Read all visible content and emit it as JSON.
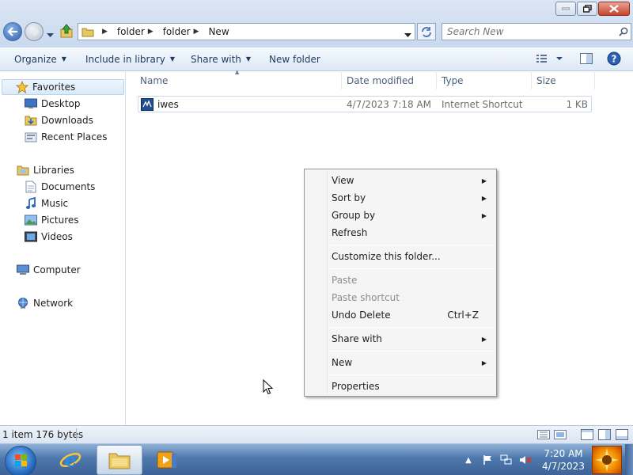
{
  "address": {
    "crumbs": [
      "folder",
      "folder",
      "New"
    ]
  },
  "search": {
    "placeholder": "Search New"
  },
  "commandbar": {
    "organize": "Organize",
    "include_in_library": "Include in library",
    "share_with": "Share with",
    "new_folder": "New folder"
  },
  "sidebar": {
    "favorites": "Favorites",
    "desktop": "Desktop",
    "downloads": "Downloads",
    "recent_places": "Recent Places",
    "libraries": "Libraries",
    "documents": "Documents",
    "music": "Music",
    "pictures": "Pictures",
    "videos": "Videos",
    "computer": "Computer",
    "network": "Network"
  },
  "columns": {
    "name": "Name",
    "date": "Date modified",
    "type": "Type",
    "size": "Size"
  },
  "files": [
    {
      "name": "iwes",
      "date": "4/7/2023 7:18 AM",
      "type": "Internet Shortcut",
      "size": "1 KB"
    }
  ],
  "context_menu": {
    "view": "View",
    "sort_by": "Sort by",
    "group_by": "Group by",
    "refresh": "Refresh",
    "customize": "Customize this folder...",
    "paste": "Paste",
    "paste_shortcut": "Paste shortcut",
    "undo_delete": "Undo Delete",
    "undo_shortcut": "Ctrl+Z",
    "share_with": "Share with",
    "new": "New",
    "properties": "Properties"
  },
  "status": {
    "text": "1 item  176 bytes"
  },
  "taskbar": {
    "time": "7:20 AM",
    "date": "4/7/2023"
  }
}
